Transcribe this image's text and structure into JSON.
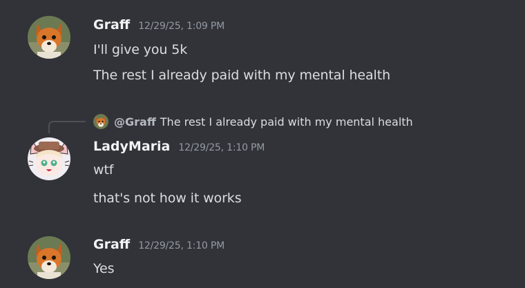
{
  "messages": [
    {
      "author": "Graff",
      "timestamp": "12/29/25, 1:09 PM",
      "avatar_icon": "fox-avatar",
      "lines": [
        "I'll give you 5k",
        "The rest I already paid with my mental health"
      ]
    },
    {
      "author": "LadyMaria",
      "timestamp": "12/29/25, 1:10 PM",
      "avatar_icon": "anime-girl-avatar",
      "reply": {
        "mention": "@Graff",
        "text": "The rest I already paid with my mental health",
        "avatar_icon": "fox-avatar"
      },
      "lines": [
        "wtf",
        "that's not how it works"
      ]
    },
    {
      "author": "Graff",
      "timestamp": "12/29/25, 1:10 PM",
      "avatar_icon": "fox-avatar",
      "lines": [
        "Yes"
      ]
    }
  ],
  "colors": {
    "background": "#313338",
    "username": "#f2f3f5",
    "timestamp": "#949ba4",
    "message_text": "#dbdee1",
    "reply_spine": "#4e5058"
  }
}
